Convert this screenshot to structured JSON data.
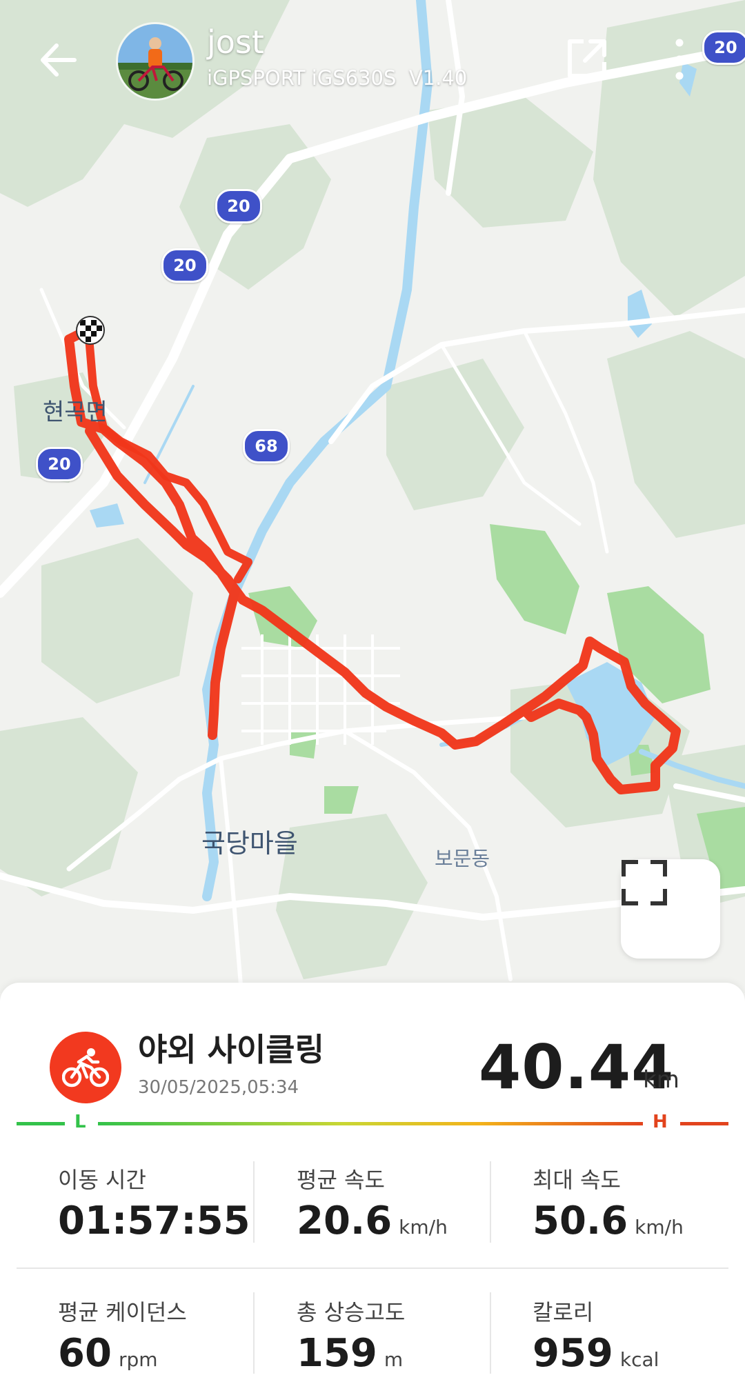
{
  "header": {
    "user_name": "jost",
    "device": "iGPSPORT iGS630S  V1.40"
  },
  "map": {
    "place_labels": [
      "현곡면",
      "국당마을",
      "보문동"
    ],
    "road_shields": [
      "20",
      "20",
      "20",
      "20",
      "68"
    ]
  },
  "activity": {
    "type": "야외 사이클링",
    "datetime": "30/05/2025,05:34",
    "distance": "40.44",
    "distance_unit": "km",
    "scale_low": "L",
    "scale_high": "H",
    "stats": [
      {
        "label": "이동 시간",
        "value": "01:57:55",
        "unit": ""
      },
      {
        "label": "평균 속도",
        "value": "20.6",
        "unit": "km/h"
      },
      {
        "label": "최대 속도",
        "value": "50.6",
        "unit": "km/h"
      },
      {
        "label": "평균 케이던스",
        "value": "60",
        "unit": "rpm"
      },
      {
        "label": "총 상승고도",
        "value": "159",
        "unit": "m"
      },
      {
        "label": "칼로리",
        "value": "959",
        "unit": "kcal"
      }
    ]
  },
  "colors": {
    "route": "#f0361a",
    "accent": "#f2391f",
    "water": "#a9d8f3",
    "park": "#a8dca0",
    "forest": "#d6e4d2",
    "road_shield": "#3f51c8"
  }
}
